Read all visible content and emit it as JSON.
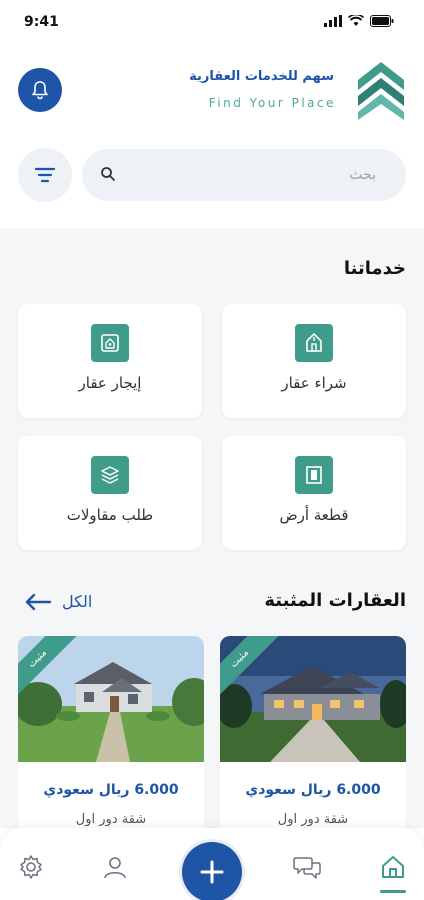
{
  "status_bar": {
    "time": "9:41"
  },
  "header": {
    "brand_name": "سهم للخدمات العقارية",
    "tagline": "Find Your Place"
  },
  "search": {
    "placeholder": "بحث",
    "value": ""
  },
  "services": {
    "title": "خدماتنا",
    "items": [
      {
        "label": "شراء عقار",
        "icon": "house-buy-icon"
      },
      {
        "label": "إيجار عقار",
        "icon": "house-rent-icon"
      },
      {
        "label": "قطعة أرض",
        "icon": "land-plot-icon"
      },
      {
        "label": "طلب مقاولات",
        "icon": "layers-icon"
      }
    ]
  },
  "featured": {
    "title": "العقارات المثبتة",
    "see_all": "الكل",
    "items": [
      {
        "badge": "مثبت",
        "price": "6.000 ريال سعودي",
        "desc": "شقة دور اول"
      },
      {
        "badge": "مثبت",
        "price": "6.000 ريال سعودي",
        "desc": "شقة دور اول"
      }
    ]
  },
  "nav": {
    "items": [
      "home-icon",
      "chat-icon",
      "add-icon",
      "user-icon",
      "settings-icon"
    ],
    "active": "home-icon"
  },
  "colors": {
    "primary": "#1e55a6",
    "accent": "#3f9b8a",
    "background": "#f5f6f8"
  }
}
